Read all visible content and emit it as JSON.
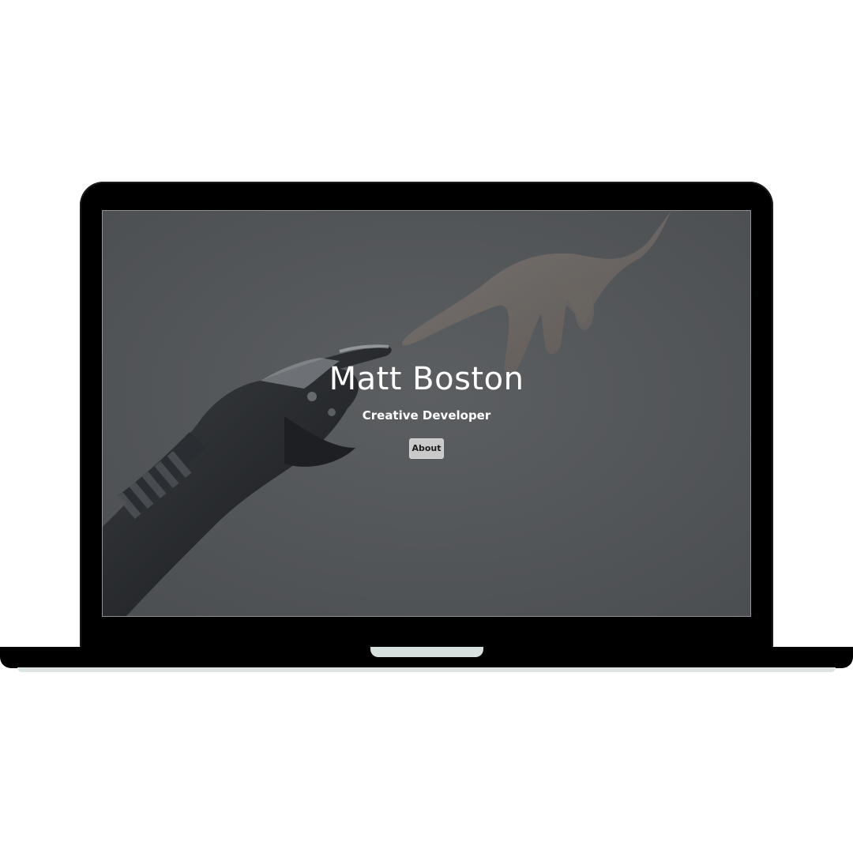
{
  "hero": {
    "title": "Matt Boston",
    "subtitle": "Creative Developer",
    "about_label": "About"
  },
  "background_image": {
    "description_icon": "robot-hand-reaching-human-hand-image"
  },
  "colors": {
    "overlay": "#56595c",
    "text": "#ffffff",
    "button_bg": "#c9c9c9",
    "button_text": "#1a1a1a",
    "device_frame": "#000000"
  }
}
